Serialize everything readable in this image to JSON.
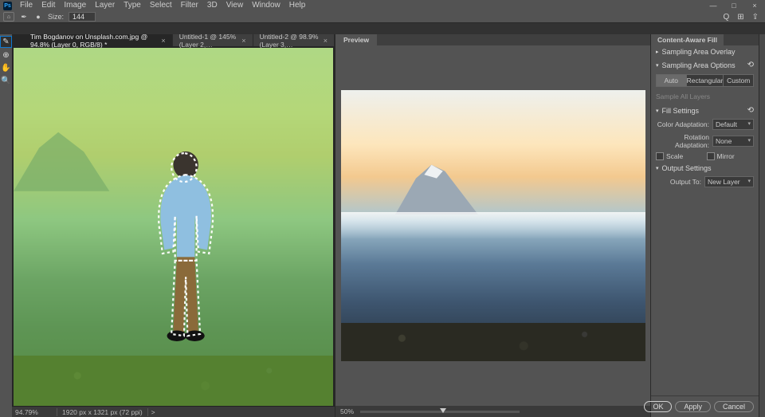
{
  "menu": {
    "items": [
      "File",
      "Edit",
      "Image",
      "Layer",
      "Type",
      "Select",
      "Filter",
      "3D",
      "View",
      "Window",
      "Help"
    ],
    "logo": "Ps"
  },
  "window_controls": {
    "min": "—",
    "max": "□",
    "close": "×"
  },
  "optbar": {
    "pen_icon": "✒",
    "brush_icon": "●",
    "size_label": "Size:",
    "size_value": "144",
    "right_icons": {
      "search": "Q",
      "collapse": "⊞",
      "share": "⇪"
    }
  },
  "tabs": [
    {
      "label": "Tim Bogdanov on Unsplash.com.jpg @ 94.8% (Layer 0, RGB/8) *",
      "active": true
    },
    {
      "label": "Untitled-1 @ 145% (Layer 2,…",
      "active": false
    },
    {
      "label": "Untitled-2 @ 98.9% (Layer 3,…",
      "active": false
    }
  ],
  "tools": [
    "✎",
    "⊕",
    "✋",
    "🔍"
  ],
  "statusL": {
    "zoom": "94.79%",
    "doc": "1920 px x 1321 px (72 ppi)",
    "arrow": ">"
  },
  "preview": {
    "tab": "Preview",
    "zoom": "50%"
  },
  "panel": {
    "title": "Content-Aware Fill",
    "sec_overlay": "Sampling Area Overlay",
    "sec_options": "Sampling Area Options",
    "seg": [
      "Auto",
      "Rectangular",
      "Custom"
    ],
    "seg_selected": 0,
    "sample_all": "Sample All Layers",
    "sec_fill": "Fill Settings",
    "color_adapt": {
      "label": "Color Adaptation:",
      "value": "Default"
    },
    "rot_adapt": {
      "label": "Rotation Adaptation:",
      "value": "None"
    },
    "chk_scale": "Scale",
    "chk_mirror": "Mirror",
    "sec_output": "Output Settings",
    "output_to": {
      "label": "Output To:",
      "value": "New Layer"
    },
    "reset_icon": "⟲"
  },
  "buttons": {
    "ok": "OK",
    "apply": "Apply",
    "cancel": "Cancel"
  }
}
